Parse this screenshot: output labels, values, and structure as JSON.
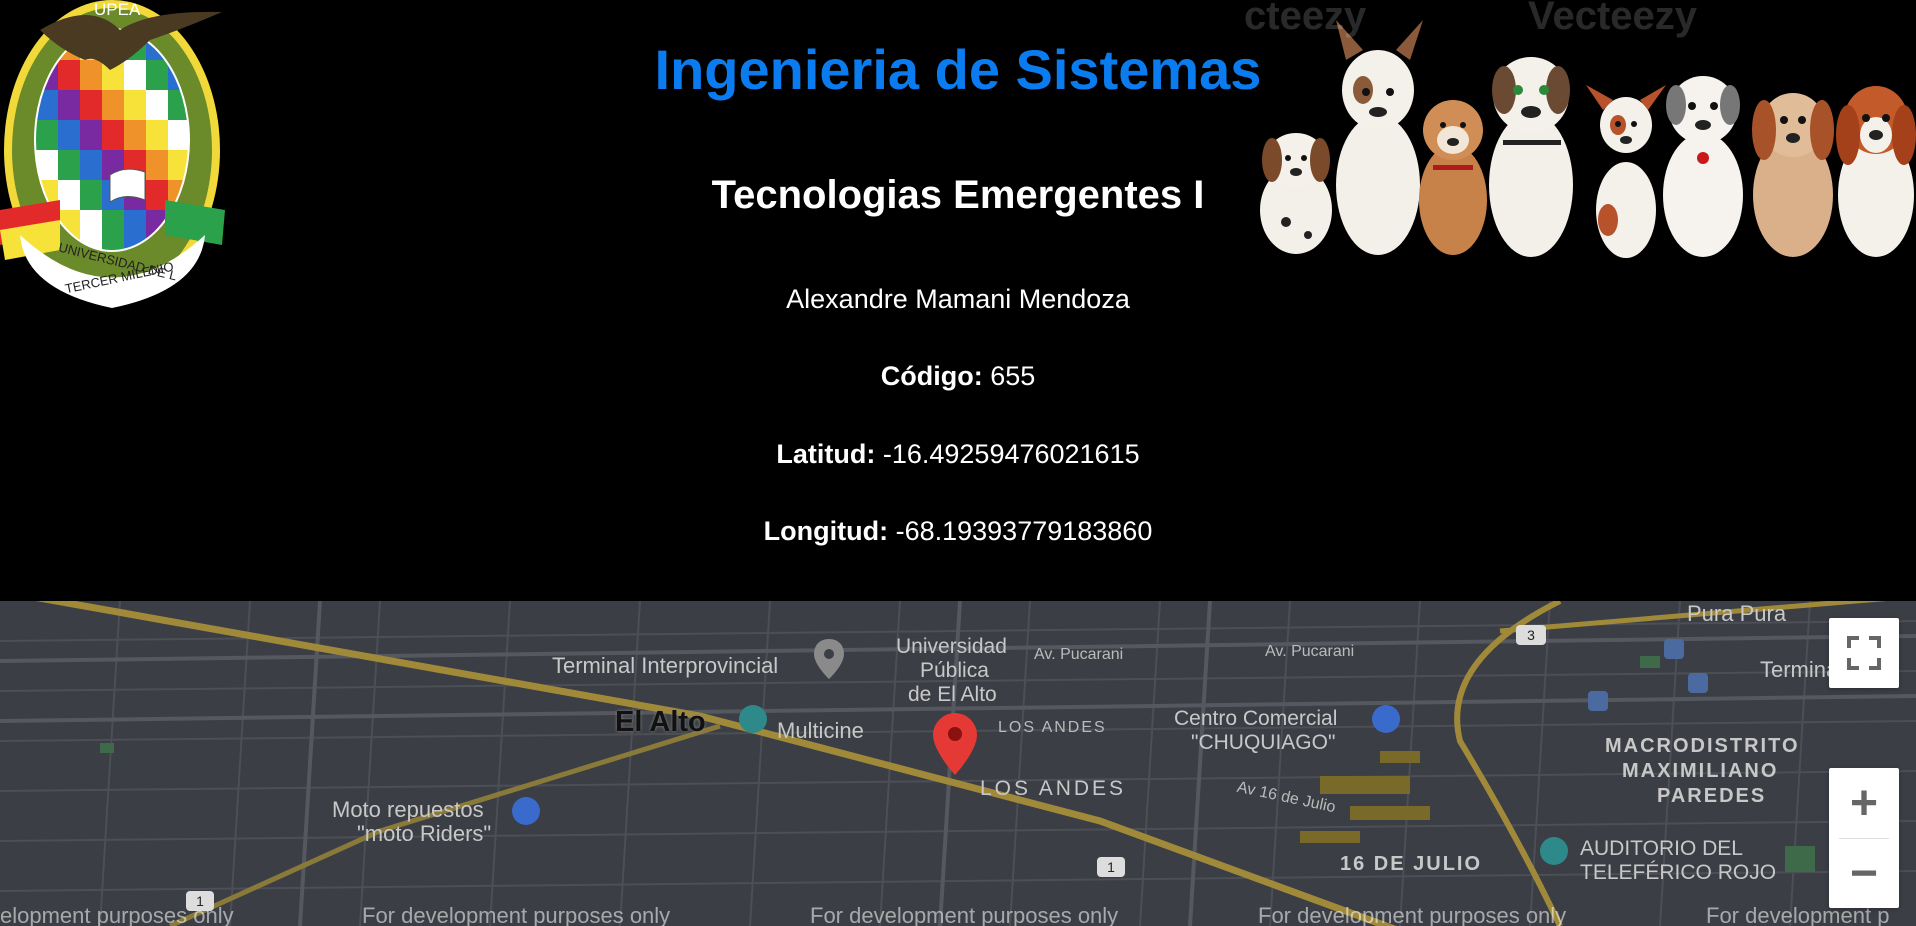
{
  "header": {
    "title": "Ingenieria de Sistemas",
    "subtitle": "Tecnologias Emergentes I",
    "student_name": "Alexandre Mamani Mendoza",
    "code": {
      "label": "Código:",
      "value": "655"
    },
    "latitude": {
      "label": "Latitud:",
      "value": "-16.49259476021615"
    },
    "longitude": {
      "label": "Longitud:",
      "value": "-68.19393779183860"
    },
    "colors": {
      "title": "#0a7cf0",
      "background": "#000000"
    }
  },
  "logo": {
    "top_text": "UPEA",
    "ring_text": "UNIVERSIDAD PÚBLICA DE EL ALTO",
    "bottom_text_1": "UNIVERSIDAD DE L",
    "bottom_text_2": "TERCER MILENIO"
  },
  "banner": {
    "watermark_1": "cteezy",
    "watermark_2": "Vecteezy",
    "icon": "dogs-illustration"
  },
  "map": {
    "labels": {
      "el_alto": "El Alto",
      "terminal": "Terminal Interprovincial",
      "university_1": "Universidad",
      "university_2": "Pública",
      "university_3": "de El Alto",
      "av_pucarani_1": "Av. Pucarani",
      "av_pucarani_2": "Av. Pucarani",
      "pura_pura": "Pura Pura",
      "terminal_right": "Termina",
      "multicine": "Multicine",
      "los_andes_small": "LOS ANDES",
      "los_andes": "LOS ANDES",
      "centro_1": "Centro Comercial",
      "centro_2": "\"CHUQUIAGO\"",
      "macro_1": "MACRODISTRITO",
      "macro_2": "MAXIMILIANO",
      "macro_3": "PAREDES",
      "av16": "Av 16 de Julio",
      "moto_1": "Moto repuestos",
      "moto_2": "\"moto Riders\"",
      "dieciseis": "16 DE JULIO",
      "auditorio_1": "AUDITORIO DEL",
      "auditorio_2": "TELEFÉRICO ROJO",
      "shield_1": "1",
      "shield_3": "3",
      "shield_1b": "1"
    },
    "dev_notice": "For development purposes only",
    "dev_notice_1": "elopment purposes only",
    "dev_notice_last": "For development p",
    "controls": {
      "fullscreen_icon": "fullscreen-icon",
      "zoom_in": "+",
      "zoom_out": "−"
    },
    "marker_icon": "map-pin-icon"
  }
}
